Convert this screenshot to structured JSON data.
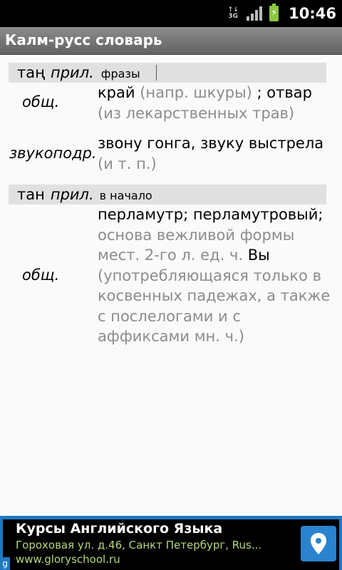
{
  "status_bar": {
    "network": "3G",
    "time": "10:46"
  },
  "app": {
    "title": "Калм-русс словарь"
  },
  "entries": [
    {
      "word": "таң",
      "pos": "прил.",
      "phrase": "фразы",
      "senses": [
        {
          "label": "общ.",
          "def_main": "край",
          "def_note": "(напр. шкуры)",
          "def_main2": "; отвар",
          "def_note2": "(из лекарственных трав)"
        },
        {
          "label": "звукоподр.",
          "def_main": "звону гонга, звуку выстрела",
          "def_note": "(и т. п.)"
        }
      ]
    },
    {
      "word": "тан",
      "pos": "прил.",
      "phrase": "в начало",
      "senses": [
        {
          "label": "общ.",
          "def_main": "перламутр; перламутровый;",
          "def_note": "основа вежливой формы мест. 2-го л. ед. ч.",
          "def_main2": "Вы",
          "def_note2": "(употребляющаяся только в косвенных падежах, а также с послелогами и с аффиксами мн. ч.)"
        }
      ]
    }
  ],
  "ad": {
    "title": "Курсы Английского Языка",
    "address": "Гороховая ул. д.46, Санкт Петербург, Rus...",
    "url": "www.gloryschool.ru",
    "icon": "map-pin-icon",
    "badge": "g"
  },
  "colors": {
    "status_bar": "#000000",
    "title_bar": "#757575",
    "entry_header": "#e0e0e0",
    "note_text": "#8c8c8c",
    "ad_frame": "#1f78c2",
    "ad_text": "#b5d87a"
  }
}
